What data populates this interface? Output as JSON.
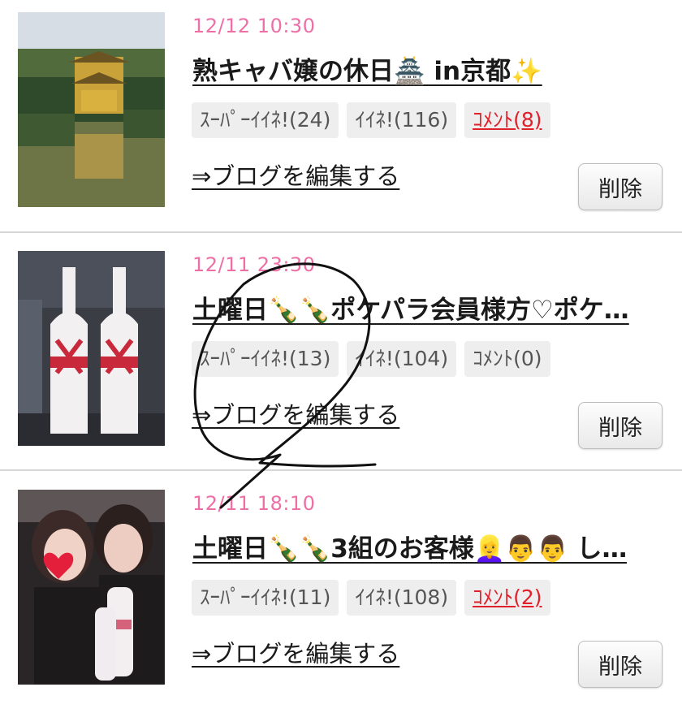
{
  "posts": [
    {
      "date": "12/12 10:30",
      "title": "熟キャバ嬢の休日🏯 in京都✨",
      "super_like": "ｽｰﾊﾟｰｲｲﾈ!(24)",
      "like": "ｲｲﾈ!(116)",
      "comment": "ｺﾒﾝﾄ(8)",
      "comment_highlight": true,
      "edit_label": "⇒ブログを編集する",
      "delete_label": "削除",
      "image": "golden-pavilion-photo"
    },
    {
      "date": "12/11 23:30",
      "title": "土曜日🍾🍾ポケパラ会員様方♡ポケ…",
      "super_like": "ｽｰﾊﾟｰｲｲﾈ!(13)",
      "like": "ｲｲﾈ!(104)",
      "comment": "ｺﾒﾝﾄ(0)",
      "comment_highlight": false,
      "edit_label": "⇒ブログを編集する",
      "delete_label": "削除",
      "image": "champagne-bottles-photo"
    },
    {
      "date": "12/11 18:10",
      "title": "土曜日🍾🍾3組のお客様👱‍♀️👨👨 し…",
      "super_like": "ｽｰﾊﾟｰｲｲﾈ!(11)",
      "like": "ｲｲﾈ!(108)",
      "comment": "ｺﾒﾝﾄ(2)",
      "comment_highlight": true,
      "edit_label": "⇒ブログを編集する",
      "delete_label": "削除",
      "image": "two-women-photo"
    }
  ],
  "colors": {
    "date": "#ee6fa6",
    "comment_active": "#e0202a",
    "badge_bg": "#eeeeee",
    "divider": "#d6d6d6"
  }
}
